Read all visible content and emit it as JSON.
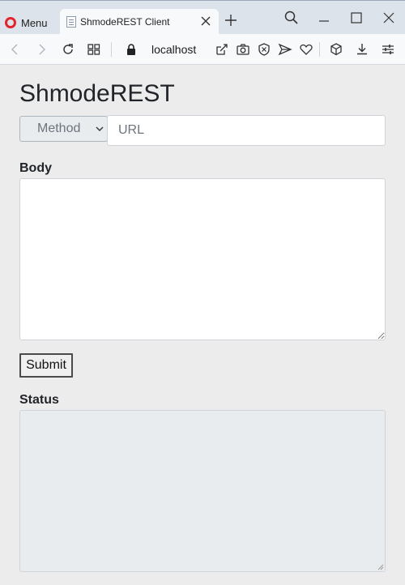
{
  "browser": {
    "menu_label": "Menu",
    "tab_title": "ShmodeREST Client",
    "address": "localhost"
  },
  "app": {
    "title": "ShmodeREST",
    "method_placeholder": "Method",
    "url_placeholder": "URL",
    "body_label": "Body",
    "submit_label": "Submit",
    "status_label": "Status"
  },
  "colors": {
    "opera_red": "#e3242b",
    "page_background": "#ececec",
    "readonly_field": "#e9ecef"
  },
  "icons": [
    "opera-logo-icon",
    "page-favicon-icon",
    "close-icon",
    "plus-icon",
    "search-icon",
    "minimize-icon",
    "maximize-icon",
    "back-arrow-icon",
    "forward-arrow-icon",
    "reload-icon",
    "tabs-grid-icon",
    "lock-icon",
    "share-icon",
    "camera-icon",
    "shield-icon",
    "send-icon",
    "heart-icon",
    "cube-icon",
    "download-icon",
    "settings-sliders-icon",
    "chevron-down-icon"
  ]
}
